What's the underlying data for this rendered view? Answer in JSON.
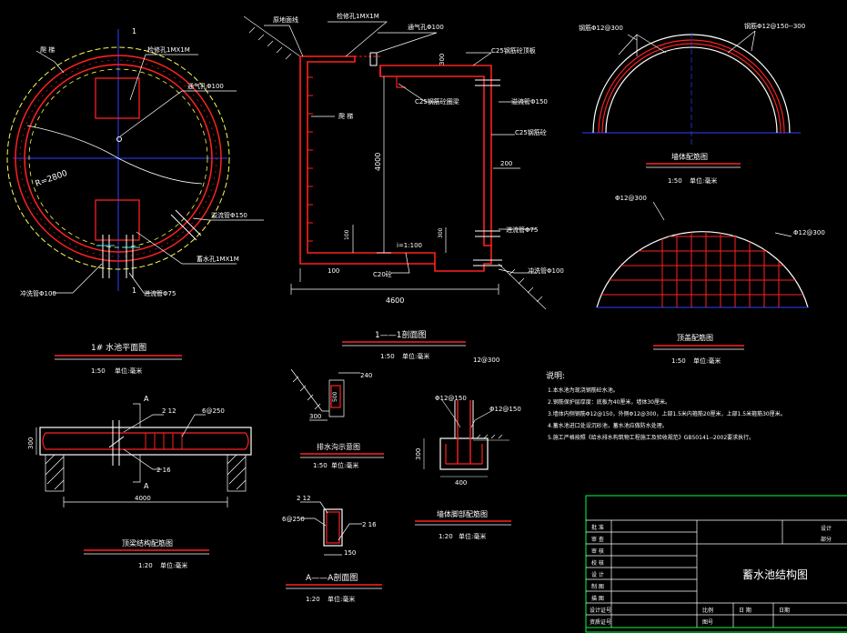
{
  "colors": {
    "background": "#000000",
    "wall": "#ff2020",
    "white": "#ffffff",
    "yellow": "#ffff55",
    "blue": "#3040ff",
    "cyan": "#40e0ff",
    "green": "#00ff44"
  },
  "plan_view": {
    "label_top_left": "爬 梯",
    "label_manhole": "检修孔1MX1M",
    "label_vent": "通气孔Φ100",
    "label_radius": "R=2800",
    "label_overflow": "溢流管Φ150",
    "label_inlet_hole": "蓄水孔1MX1M",
    "label_drain": "冲洗管Φ100",
    "label_inlet_pipe": "进流管Φ75",
    "section_mark_top": "1",
    "section_mark_bottom": "1",
    "title": "1# 水池平面图",
    "scale": "1:50",
    "unit": "单位:毫米"
  },
  "section_view": {
    "label_backfill": "原地面线",
    "label_manhole": "检修孔1MX1M",
    "label_vent": "通气孔Φ100",
    "label_c25_top": "C25钢筋砼顶板",
    "label_c25_beam": "C25钢筋砼圈梁",
    "label_overflow": "溢流管Φ150",
    "label_c25_wall": "C25钢筋砼",
    "label_ladder": "爬 梯",
    "label_inlet": "进流管Φ75",
    "label_drain": "冲洗管Φ100",
    "label_floor": "C20砼",
    "dim_top": "300",
    "dim_height": "4000",
    "dim_200": "200",
    "dim_100_left": "100",
    "dim_100_bottom": "100",
    "dim_300_right": "300",
    "dim_slope": "i=1:100",
    "dim_width": "4600",
    "title": "1——1剖面图",
    "scale": "1:50",
    "unit": "单位:毫米",
    "rebar_note": "12@300"
  },
  "wall_rebar": {
    "label_left": "钢筋Φ12@300",
    "label_right": "钢筋Φ12@150--300",
    "title": "墙体配筋图",
    "scale": "1:50",
    "unit": "单位:毫米"
  },
  "top_rebar": {
    "label_left": "Φ12@300",
    "label_right": "Φ12@300",
    "title": "顶盖配筋图",
    "scale": "1:50",
    "unit": "单位:毫米"
  },
  "notes": {
    "heading": "说明:",
    "items": [
      "1.本水池为现浇钢筋砼水池。",
      "2.钢筋保护层厚度：底板为40厘米，墙体30厘米。",
      "3.墙体内侧钢筋Φ12@150，外侧Φ12@300，上部1.5米内箍筋20厘米，上部1.5米箍筋30厘米。",
      "4.蓄水池进口处设沉砂池，蓄水池应做防水处理。",
      "5.施工严格按照《给水排水构筑物工程施工及验收规范》GB50141--2002要求执行。"
    ]
  },
  "roof_beam": {
    "label_top": "2  12",
    "label_bottom": "2  16",
    "label_stirrup": "6@250",
    "dim_300": "300",
    "dim_width": "4000",
    "mark_a_top": "A",
    "mark_a_bottom": "A",
    "title": "顶梁结构配筋图",
    "scale": "1:20",
    "unit": "单位:毫米"
  },
  "trough": {
    "dim_240": "240",
    "dim_500": "500",
    "dim_300": "300",
    "title": "排水沟示意图",
    "scale": "1:50",
    "unit": "单位:毫米"
  },
  "a_section": {
    "label_top": "2  12",
    "label_stirrup": "6@250",
    "label_bottom": "2  16",
    "dim_150": "150",
    "title": "A——A剖面图",
    "scale": "1:20",
    "unit": "单位:毫米"
  },
  "footing": {
    "label_left": "Φ12@150",
    "label_right": "Φ12@150",
    "dim_300": "300",
    "dim_400": "400",
    "title": "墙体脚部配筋图",
    "scale": "1:20",
    "unit": "单位:毫米"
  },
  "title_block": {
    "drawing_title": "蓄水池结构图",
    "rows": [
      "批 准",
      "审 查",
      "审 核",
      "校 核",
      "设 计",
      "制 图",
      "描 图",
      "设计证号",
      "资质证号"
    ],
    "right_top_1": "设计",
    "right_top_2": "部分",
    "bottom_scale": "比例",
    "bottom_date1": "日 期",
    "bottom_date2": "日期",
    "bottom_sheet": "图号"
  }
}
